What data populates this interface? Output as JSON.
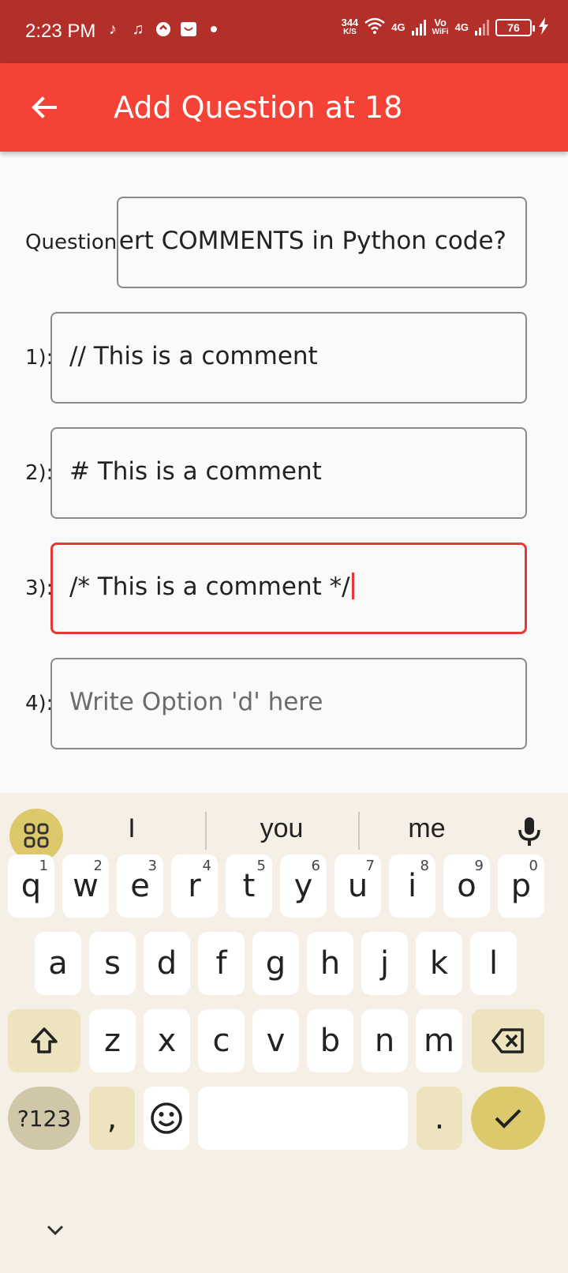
{
  "status_bar": {
    "time": "2:23 PM",
    "net_speed": "344",
    "net_speed_unit": "K/S",
    "lte1": "4G",
    "vowifi_top": "Vo",
    "vowifi_bottom": "WiFi",
    "lte2": "4G",
    "battery": "76"
  },
  "app_bar": {
    "title": "Add Question at 18"
  },
  "form": {
    "question_label": "Question:",
    "question_value": "ısert COMMENTS in Python code?",
    "options": [
      {
        "label": "1):",
        "value": "// This is a comment",
        "placeholder": ""
      },
      {
        "label": "2):",
        "value": "# This is a comment",
        "placeholder": ""
      },
      {
        "label": "3):",
        "value": "/* This is a comment */",
        "placeholder": ""
      },
      {
        "label": "4):",
        "value": "",
        "placeholder": "Write Option 'd' here"
      }
    ]
  },
  "keyboard": {
    "suggestions": [
      "I",
      "you",
      "me"
    ],
    "row1": [
      {
        "k": "q",
        "n": "1"
      },
      {
        "k": "w",
        "n": "2"
      },
      {
        "k": "e",
        "n": "3"
      },
      {
        "k": "r",
        "n": "4"
      },
      {
        "k": "t",
        "n": "5"
      },
      {
        "k": "y",
        "n": "6"
      },
      {
        "k": "u",
        "n": "7"
      },
      {
        "k": "i",
        "n": "8"
      },
      {
        "k": "o",
        "n": "9"
      },
      {
        "k": "p",
        "n": "0"
      }
    ],
    "row2": [
      "a",
      "s",
      "d",
      "f",
      "g",
      "h",
      "j",
      "k",
      "l"
    ],
    "row3": [
      "z",
      "x",
      "c",
      "v",
      "b",
      "n",
      "m"
    ],
    "symbols_label": "?123",
    "comma": ",",
    "period": "."
  },
  "colors": {
    "status_bar": "#b3302a",
    "app_bar": "#f44336",
    "focus": "#e53935",
    "keyboard_bg": "#f6efe6",
    "accent_key": "#dcc96b"
  }
}
